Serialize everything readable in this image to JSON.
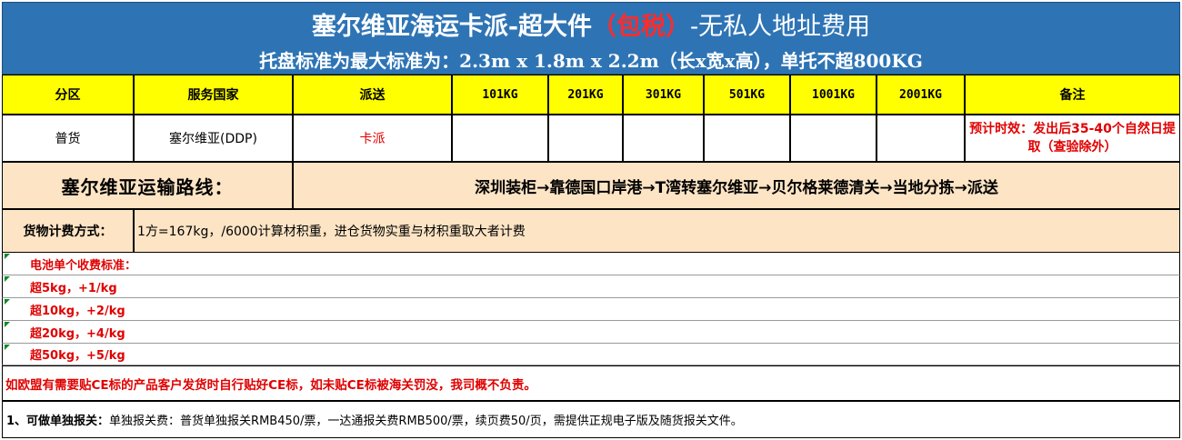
{
  "header": {
    "title_main": "塞尔维亚海运卡派-超大件",
    "title_red": "（包税）",
    "title_tail": "-无私人地址费用",
    "subtitle": "托盘标准为最大标准为：2.3m x 1.8m x 2.2m（长x宽x高），单托不超800KG"
  },
  "table": {
    "headers": [
      "分区",
      "服务国家",
      "派送",
      "101KG",
      "201KG",
      "301KG",
      "501KG",
      "1001KG",
      "2001KG",
      "备注"
    ],
    "row": {
      "zone": "普货",
      "country": "塞尔维亚(DDP)",
      "delivery": "卡派",
      "prices": [
        "",
        "",
        "",
        "",
        "",
        ""
      ],
      "note": "预计时效：发出后35-40个自然日提取（查验除外）"
    }
  },
  "route": {
    "label": "塞尔维亚运输路线：",
    "text": "深圳装柜→靠德国口岸港→T湾转塞尔维亚→贝尔格莱德清关→当地分拣→派送"
  },
  "billing": {
    "label": "货物计费方式：",
    "text": "1方=167kg，/6000计算材积重，进仓货物实重与材积重取大者计费"
  },
  "battery": {
    "title": "电池单个收费标准：",
    "lines": [
      "超5kg，+1/kg",
      "超10kg，+2/kg",
      "超20kg，+4/kg",
      "超50kg，+5/kg"
    ]
  },
  "ce_notice": "如欧盟有需要贴CE标的产品客户发货时自行贴好CE标，如未贴CE标被海关罚没，我司概不负责。",
  "customs": {
    "label": "1、可做单独报关：",
    "text": "单独报关费：普货单独报关RMB450/票，一达通报关费RMB500/票，续页费50/页，需提供正规电子版及随货报关文件。"
  },
  "colors": {
    "header_bg": "#2e74b5",
    "header_red": "#ff2b2b",
    "table_header_bg": "#ffff00",
    "route_bg": "#fce4c4",
    "accent_red": "#e00000"
  }
}
